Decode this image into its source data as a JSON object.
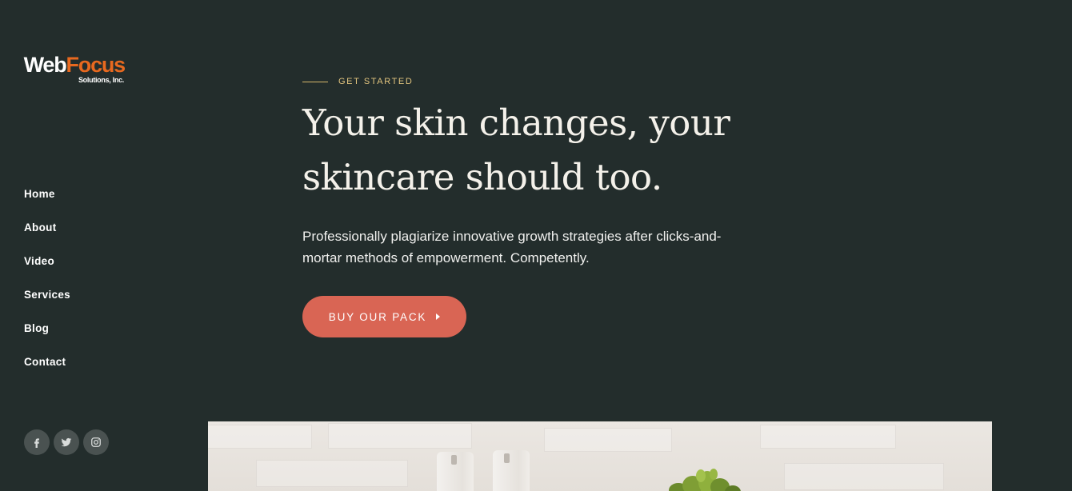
{
  "brand": {
    "name_part1": "Web",
    "name_part2": "Focus",
    "tagline": "Solutions, Inc.",
    "colors": {
      "primary_text": "#ffffff",
      "accent": "#e8691f"
    }
  },
  "nav": {
    "items": [
      {
        "label": "Home"
      },
      {
        "label": "About"
      },
      {
        "label": "Video"
      },
      {
        "label": "Services"
      },
      {
        "label": "Blog"
      },
      {
        "label": "Contact"
      }
    ]
  },
  "social": [
    {
      "icon": "facebook-icon"
    },
    {
      "icon": "twitter-icon"
    },
    {
      "icon": "instagram-icon"
    }
  ],
  "hero": {
    "eyebrow": "GET STARTED",
    "headline_line1": "Your skin changes, your",
    "headline_line2": "skincare should too.",
    "lede_line1": "Professionally plagiarize innovative growth strategies after clicks-and-",
    "lede_line2": "mortar methods of empowerment. Competently.",
    "cta_label": "BUY OUR PACK",
    "cta_icon": "caret-right-icon"
  },
  "theme": {
    "background": "#232d2c",
    "cta_color": "#d96554",
    "eyebrow_color": "#e2c47e"
  }
}
